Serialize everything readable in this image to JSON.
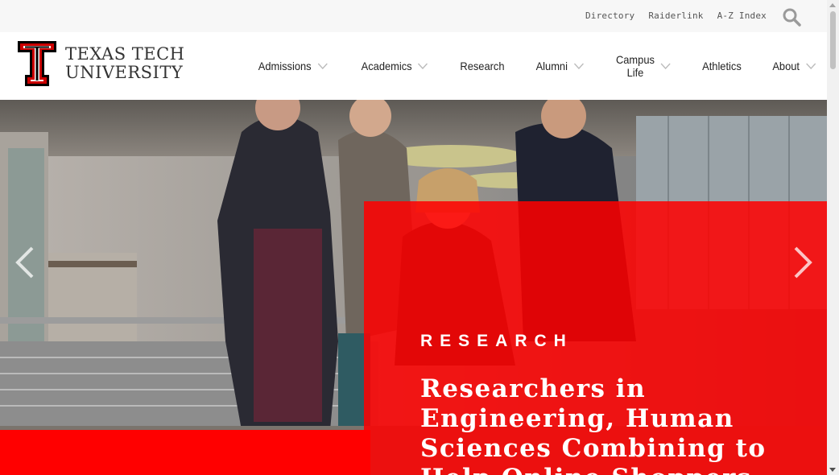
{
  "utility": {
    "links": [
      "Directory",
      "Raiderlink",
      "A-Z Index"
    ],
    "search_icon": "search-icon"
  },
  "brand": {
    "line1": "TEXAS TECH",
    "line2": "UNIVERSITY",
    "logo_icon": "double-t-logo",
    "color_red": "#cc0000",
    "color_black": "#000000"
  },
  "nav": {
    "admissions": "Admissions",
    "academics": "Academics",
    "research": "Research",
    "alumni": "Alumni",
    "campus_life_1": "Campus",
    "campus_life_2": "Life",
    "athletics": "Athletics",
    "about": "About",
    "dropdown_icon": "chevron-down-icon"
  },
  "hero": {
    "eyebrow": "RESEARCH",
    "headline": "Researchers in Engineering, Human Sciences Combining to Help Online Shoppers",
    "panel_color": "#ff0000",
    "prev_icon": "chevron-left-icon",
    "next_icon": "chevron-right-icon"
  }
}
